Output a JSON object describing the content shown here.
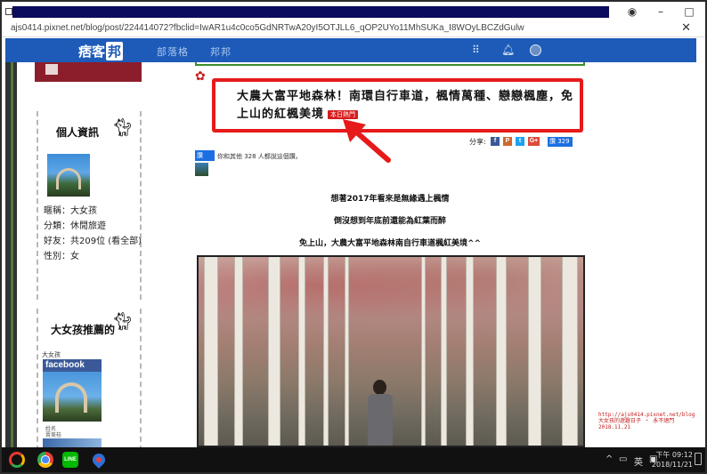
{
  "browser": {
    "url": "ajs0414.pixnet.net/blog/post/224414072?fbclid=IwAR1u4c0co5GdNRTwA20yI5OTJLL6_qOP2UYo11MhSUKa_I8WOyLBCZdGulw",
    "close_icon": "close-icon"
  },
  "site_nav": {
    "logo_text": "痞客",
    "logo_badge": "邦",
    "items": [
      "部落格",
      "邦邦"
    ],
    "apps_icon": "grid-icon",
    "bell_icon": "bell-icon"
  },
  "sidebar": {
    "profile": {
      "heading": "個人資訊",
      "rows": [
        {
          "label": "暱稱：",
          "value": "大女孩"
        },
        {
          "label": "分類：",
          "value": "休閒旅遊"
        },
        {
          "label": "好友：",
          "value": "共209位 (看全部)"
        },
        {
          "label": "性別：",
          "value": "女"
        }
      ]
    },
    "recommend": {
      "heading": "大女孩推薦的",
      "small_label": "大女孩",
      "facebook_label": "facebook",
      "caption_1": "姓名",
      "caption_2": "賣美桂"
    }
  },
  "post": {
    "title": "大農大富平地森林！南環自行車道，楓情萬種、戀戀楓塵，免上山的紅楓美境",
    "hot_badge": "本日熱門",
    "share_label": "分享:",
    "share_icons": [
      {
        "name": "facebook-share-icon",
        "letter": "f",
        "color": "#3b5998"
      },
      {
        "name": "plurk-share-icon",
        "letter": "P",
        "color": "#cf682f"
      },
      {
        "name": "twitter-share-icon",
        "letter": "t",
        "color": "#1da1f2"
      },
      {
        "name": "googleplus-share-icon",
        "letter": "G+",
        "color": "#dd4b39"
      }
    ],
    "like_button": "讚 329",
    "fb_like_small": "讚",
    "fb_like_text": "你和其他 328 人都說這個讚。",
    "paragraphs": [
      "想著2017年看來是無緣遇上楓情",
      "倒沒想到年底前還能為紅葉而醉",
      "免上山，大農大富平地森林南自行車道楓紅美境^^"
    ],
    "watermark_line1": "http://ajs0414.pixnet.net/blog",
    "watermark_line2": "大女孩的遊趣日子 ‧ 永不熄門",
    "watermark_line3": "2018.11.21"
  },
  "taskbar": {
    "line_label": "LINE",
    "tray_up": "^",
    "tray_lang": "英",
    "time": "下午 09:12",
    "date": "2018/11/21"
  },
  "colors": {
    "nav_blue": "#1e5bb8",
    "highlight_red": "#e61a1a",
    "sidebar_maroon": "#8b1e2a"
  }
}
